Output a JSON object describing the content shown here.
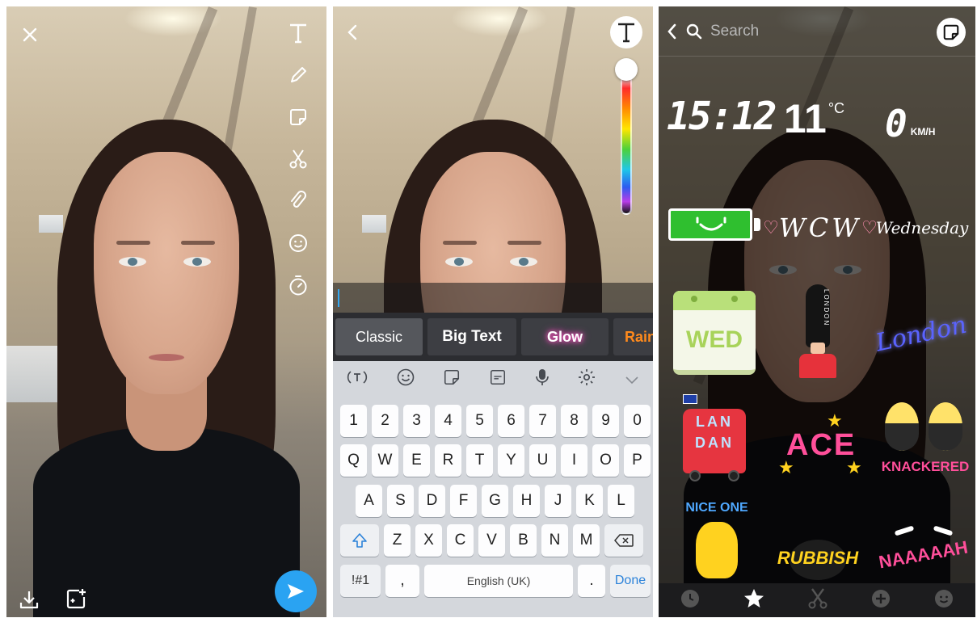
{
  "panel_keyboard": {
    "styles": [
      "Classic",
      "Big Text",
      "Glow",
      "Rain"
    ],
    "toolbar_icons": [
      "text-format-icon",
      "emoji-icon",
      "sticker-icon",
      "gif-icon",
      "microphone-icon",
      "settings-icon",
      "chevron-down-icon"
    ],
    "rows": [
      [
        "1",
        "2",
        "3",
        "4",
        "5",
        "6",
        "7",
        "8",
        "9",
        "0"
      ],
      [
        "Q",
        "W",
        "E",
        "R",
        "T",
        "Y",
        "U",
        "I",
        "O",
        "P"
      ],
      [
        "A",
        "S",
        "D",
        "F",
        "G",
        "H",
        "J",
        "K",
        "L"
      ],
      [
        "Z",
        "X",
        "C",
        "V",
        "B",
        "N",
        "M"
      ]
    ],
    "symbols_key": "!#1",
    "comma_key": ",",
    "space_label": "English (UK)",
    "period_key": ".",
    "done_label": "Done",
    "color_slider_level": 0.0
  },
  "panel_stickers": {
    "search_placeholder": "Search",
    "time": "15:12",
    "temperature": "11",
    "temp_unit": "°C",
    "speed": "0",
    "speed_unit": "KM/H",
    "stickers": {
      "wcw": "WCW",
      "wednesday": "Wednesday",
      "wed": "WED",
      "london_guard": "LONDON",
      "london_script": "London",
      "lan_dan": [
        "LAN",
        "DAN"
      ],
      "ace": "ACE",
      "knackered": "KNACKERED",
      "nice_one": "NICE ONE",
      "rubbish": "RUBBISH",
      "naaaah": "NAAAAAH"
    },
    "tabs": [
      "recent-icon",
      "favorites-icon",
      "scissors-icon",
      "add-icon",
      "emoji-icon"
    ]
  },
  "colors": {
    "send_blue": "#2aa3f2",
    "caret_blue": "#35a8f0",
    "keyboard_bg": "#d4d7dc",
    "style_bar_bg": "#2c2d31",
    "sticker_pink": "#ff2d78",
    "battery_green": "#2fbf2f"
  }
}
